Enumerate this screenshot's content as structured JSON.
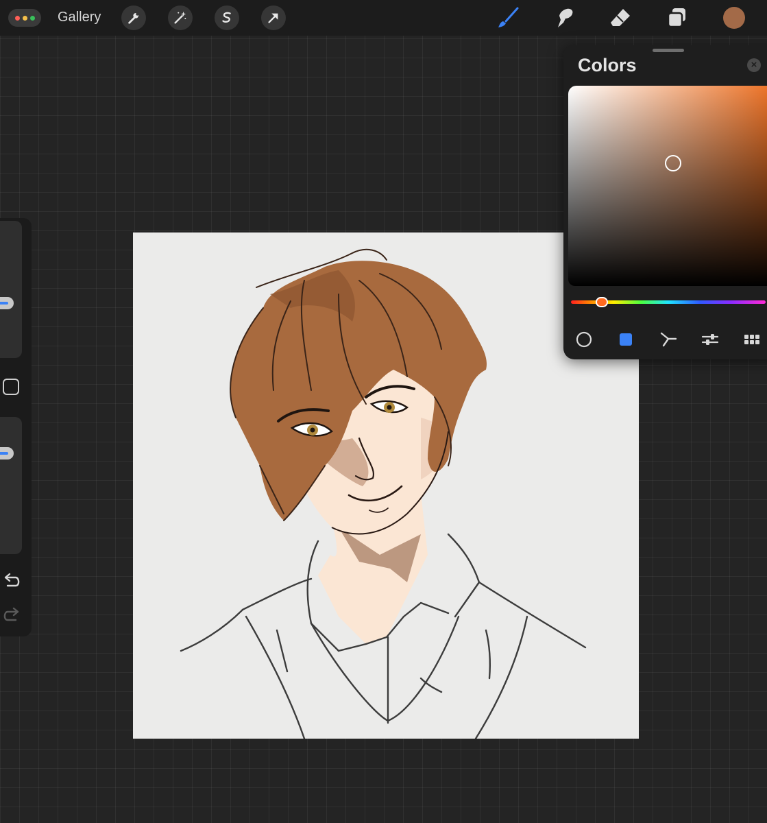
{
  "topbar": {
    "gallery_label": "Gallery",
    "tools_left": [
      {
        "name": "actions",
        "icon": "wrench-icon"
      },
      {
        "name": "adjustments",
        "icon": "magic-wand-icon"
      },
      {
        "name": "selection",
        "icon": "selection-s-icon"
      },
      {
        "name": "transform",
        "icon": "arrow-cursor-icon"
      }
    ],
    "tools_right": [
      {
        "name": "brush",
        "icon": "brush-icon",
        "active": true
      },
      {
        "name": "smudge",
        "icon": "smudge-icon"
      },
      {
        "name": "eraser",
        "icon": "eraser-icon"
      },
      {
        "name": "layers",
        "icon": "layers-icon"
      }
    ],
    "current_color": "#a36a48"
  },
  "colors_panel": {
    "title": "Colors",
    "hue_color": "#ec7023",
    "tabs": [
      {
        "name": "disc",
        "icon": "circle-outline-icon"
      },
      {
        "name": "classic",
        "icon": "square-icon",
        "active": true
      },
      {
        "name": "harmony",
        "icon": "harmony-icon"
      },
      {
        "name": "value",
        "icon": "sliders-icon"
      },
      {
        "name": "palettes",
        "icon": "grid-icon"
      }
    ]
  },
  "colors": {
    "accent": "#3b82f6",
    "background": "#242424",
    "canvas": "#ebebea",
    "hair": "#a86a3e",
    "skin": "#fbe6d4",
    "eyes": "#b08a3c"
  }
}
